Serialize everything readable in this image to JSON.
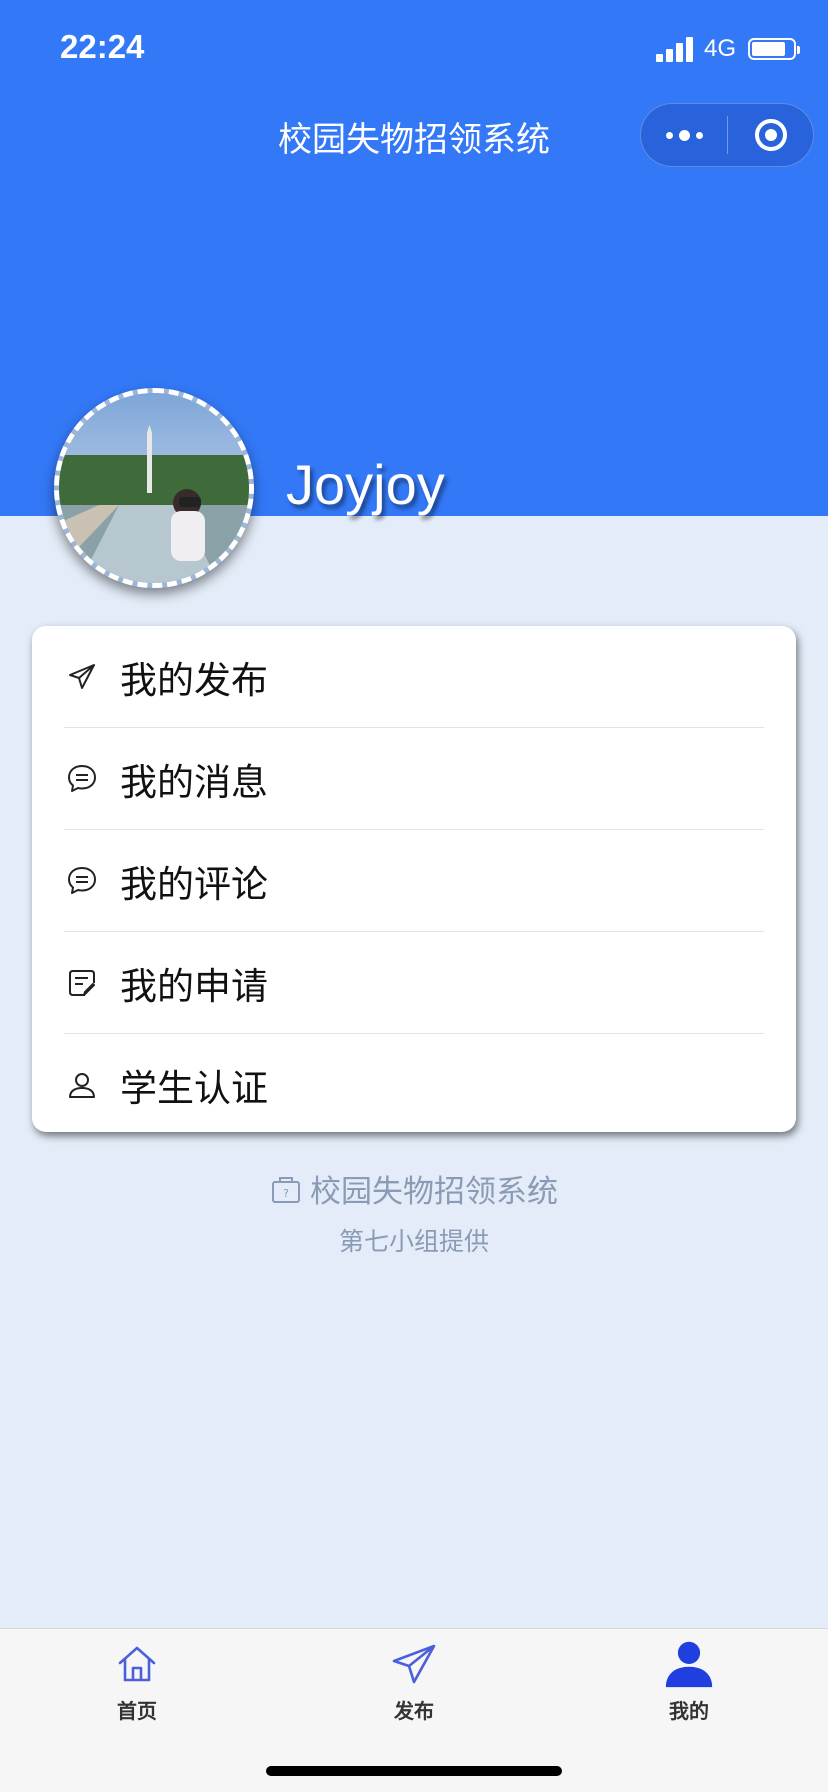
{
  "status_bar": {
    "time": "22:24",
    "network": "4G"
  },
  "nav": {
    "title": "校园失物招领系统"
  },
  "profile": {
    "username": "Joyjoy"
  },
  "menu": {
    "items": [
      {
        "label": "我的发布",
        "icon": "send-icon"
      },
      {
        "label": "我的消息",
        "icon": "chat-bubble-icon"
      },
      {
        "label": "我的评论",
        "icon": "comment-icon"
      },
      {
        "label": "我的申请",
        "icon": "application-note-icon"
      },
      {
        "label": "学生认证",
        "icon": "user-icon"
      }
    ]
  },
  "footer": {
    "brand": "校园失物招领系统",
    "credit": "第七小组提供"
  },
  "tabbar": {
    "items": [
      {
        "label": "首页",
        "icon": "home-icon"
      },
      {
        "label": "发布",
        "icon": "send-icon"
      },
      {
        "label": "我的",
        "icon": "user-filled-icon",
        "active": true
      }
    ]
  },
  "colors": {
    "header": "#3378f7",
    "background": "#e3ecf8",
    "tab_active": "#1f3fe0",
    "tab_inactive": "#4a5fd9"
  }
}
